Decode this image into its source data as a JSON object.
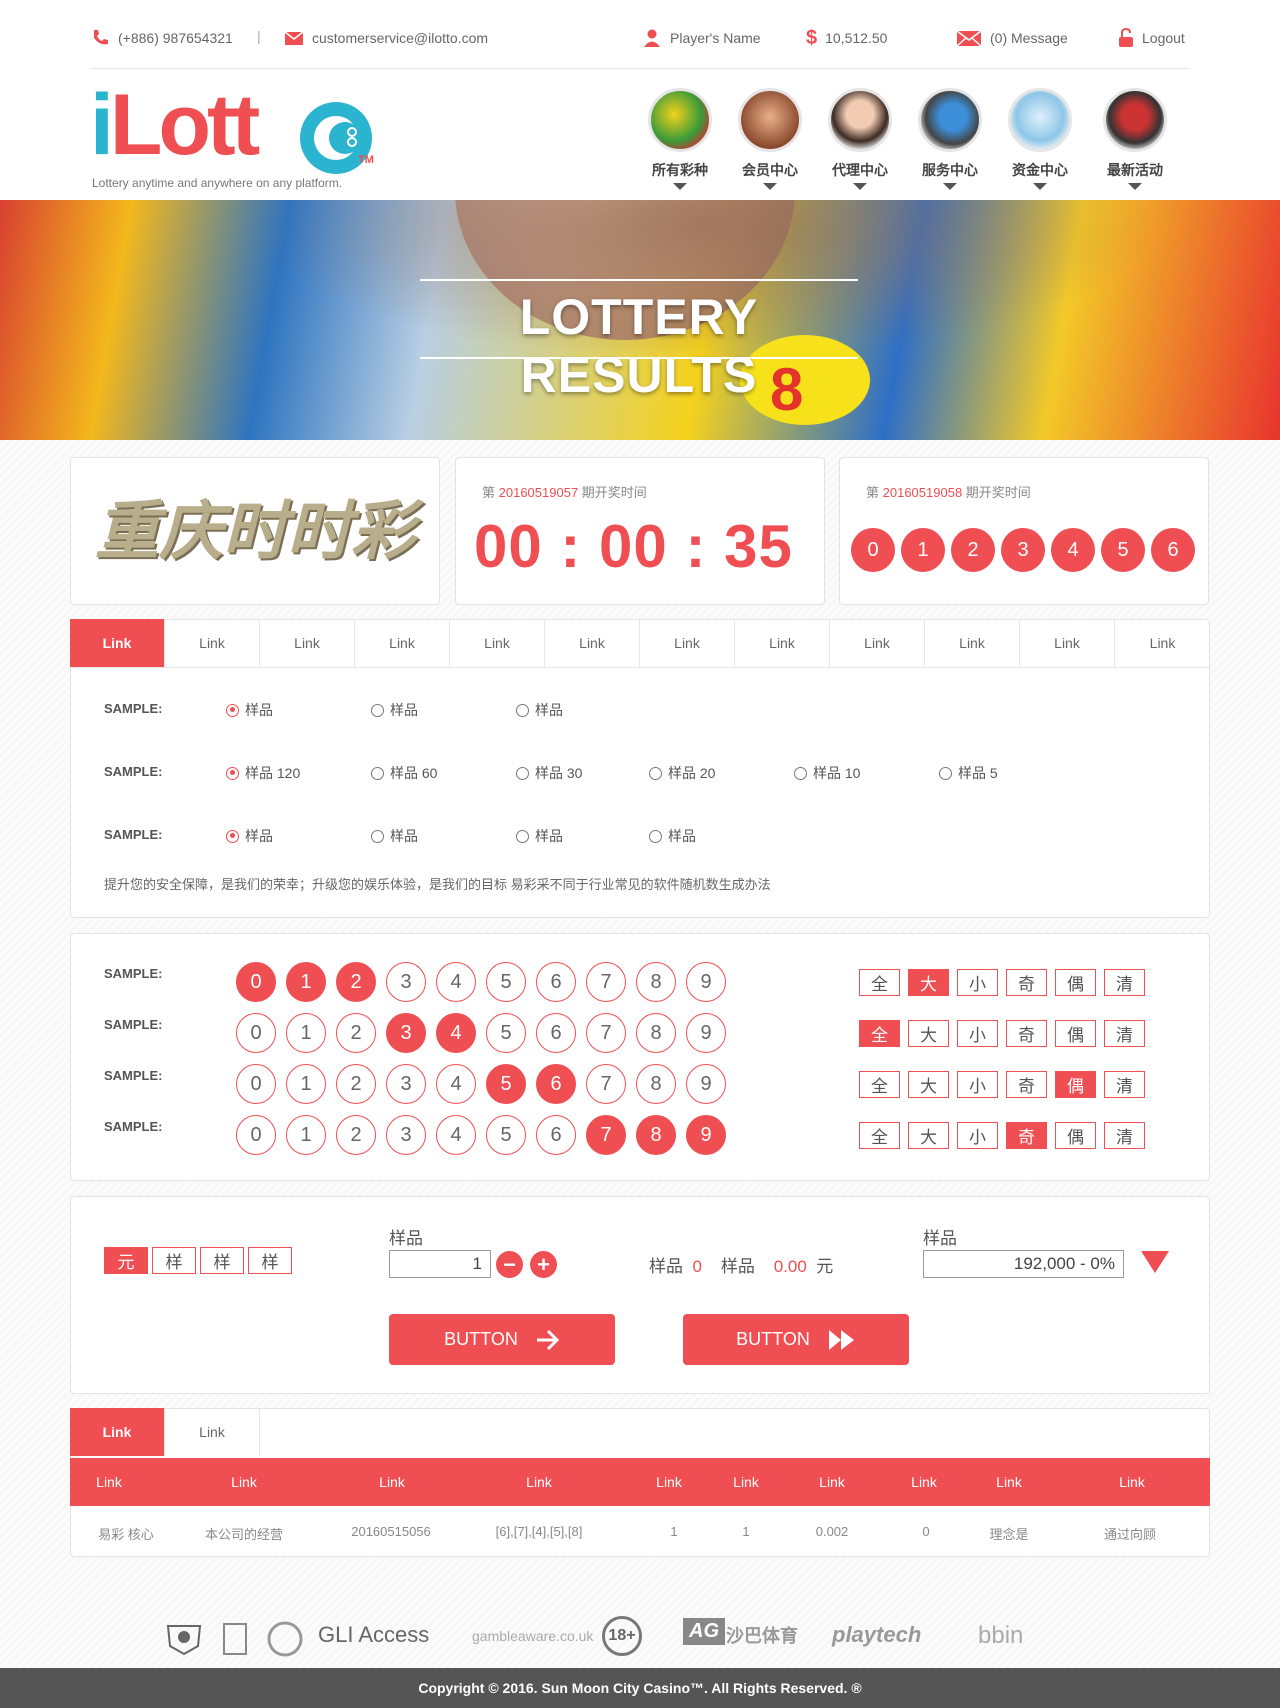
{
  "topbar": {
    "phone": "(+886) 987654321",
    "separator": "|",
    "email": "customerservice@ilotto.com",
    "player": "Player's Name",
    "balance_symbol": "$",
    "balance": "10,512.50",
    "messages": "(0) Message",
    "logout": "Logout"
  },
  "logo": {
    "text_i": "i",
    "text_rest": "Lott",
    "tm": "TM",
    "tagline": "Lottery anytime and anywhere on any platform."
  },
  "nav": [
    {
      "label": "所有彩种",
      "icon": "lottery-balls-icon"
    },
    {
      "label": "会员中心",
      "icon": "members-hands-icon"
    },
    {
      "label": "代理中心",
      "icon": "agent-headset-icon"
    },
    {
      "label": "服务中心",
      "icon": "service-247-icon"
    },
    {
      "label": "资金中心",
      "icon": "diamond-icon"
    },
    {
      "label": "最新活动",
      "icon": "tv-promo-icon"
    }
  ],
  "banner": {
    "title": "LOTTERY RESULTS"
  },
  "game": {
    "logo_text": "重庆时时彩"
  },
  "countdown": {
    "prefix": "第",
    "issue": "20160519057",
    "suffix": "期开奖时间",
    "time": "00 : 00 : 35"
  },
  "result": {
    "prefix": "第",
    "issue": "20160519058",
    "suffix": "期开奖时间",
    "balls": [
      "0",
      "1",
      "2",
      "3",
      "4",
      "5",
      "6"
    ]
  },
  "tabs": [
    "Link",
    "Link",
    "Link",
    "Link",
    "Link",
    "Link",
    "Link",
    "Link",
    "Link",
    "Link",
    "Link",
    "Link"
  ],
  "options": {
    "rows": [
      {
        "label": "SAMPLE:",
        "items": [
          "样品",
          "样品",
          "样品"
        ],
        "selected": 0
      },
      {
        "label": "SAMPLE:",
        "items": [
          "样品 120",
          "样品 60",
          "样品 30",
          "样品 20",
          "样品 10",
          "样品 5"
        ],
        "selected": 0
      },
      {
        "label": "SAMPLE:",
        "items": [
          "样品",
          "样品",
          "样品",
          "样品"
        ],
        "selected": 0
      }
    ],
    "note": "提升您的安全保障，是我们的荣幸；升级您的娱乐体验，是我们的目标 易彩采不同于行业常见的软件随机数生成办法"
  },
  "picker": {
    "digits": [
      "0",
      "1",
      "2",
      "3",
      "4",
      "5",
      "6",
      "7",
      "8",
      "9"
    ],
    "quick": [
      "全",
      "大",
      "小",
      "奇",
      "偶",
      "清"
    ],
    "rows": [
      {
        "label": "SAMPLE:",
        "selected": [
          0,
          1,
          2
        ],
        "quick_selected": 1
      },
      {
        "label": "SAMPLE:",
        "selected": [
          3,
          4
        ],
        "quick_selected": 0
      },
      {
        "label": "SAMPLE:",
        "selected": [
          5,
          6
        ],
        "quick_selected": 4
      },
      {
        "label": "SAMPLE:",
        "selected": [
          7,
          8,
          9
        ],
        "quick_selected": 3
      }
    ]
  },
  "bet": {
    "units": [
      "元",
      "样",
      "样",
      "样"
    ],
    "unit_selected": 0,
    "multiplier_label": "样品",
    "multiplier_value": "1",
    "minus": "−",
    "plus": "+",
    "count_label": "样品",
    "count_value": "0",
    "amount_label": "样品",
    "amount_value": "0.00",
    "currency": "元",
    "odds_label": "样品",
    "odds_value": "192,000 - 0%",
    "button1": "BUTTON",
    "button2": "BUTTON"
  },
  "history": {
    "tabs": [
      "Link",
      "Link"
    ],
    "headers": [
      "Link",
      "Link",
      "Link",
      "Link",
      "Link",
      "Link",
      "Link",
      "Link",
      "Link",
      "Link"
    ],
    "row": [
      "易彩 核心",
      "本公司的经营",
      "20160515056",
      "[6],[7],[4],[5],[8]",
      "1",
      "1",
      "0.002",
      "0",
      "理念是",
      "通过向顾"
    ]
  },
  "partners": [
    "GLI Access",
    "gambleaware.co.uk",
    "18+",
    "AG",
    "沙巴体育",
    "playtech",
    "bbin"
  ],
  "footer": {
    "copyright": "Copyright © 2016. Sun Moon City Casino™. All Rights Reserved. ®"
  },
  "colors": {
    "accent": "#ef4e52",
    "logo_blue": "#2ab4cf",
    "footer": "#555555"
  }
}
